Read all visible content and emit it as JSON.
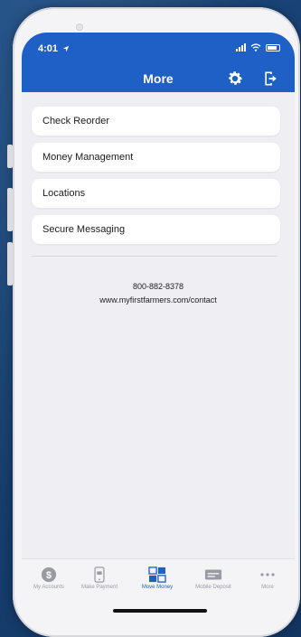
{
  "status_bar": {
    "time": "4:01"
  },
  "header": {
    "title": "More",
    "settings_icon": "gear-icon",
    "logout_icon": "logout-icon"
  },
  "menu": {
    "items": [
      {
        "label": "Check Reorder"
      },
      {
        "label": "Money Management"
      },
      {
        "label": "Locations"
      },
      {
        "label": "Secure Messaging"
      }
    ]
  },
  "contact": {
    "phone": "800-882-8378",
    "url": "www.myfirstfarmers.com/contact"
  },
  "tabbar": {
    "tabs": [
      {
        "label": "My Accounts",
        "icon": "dollar-circle-icon"
      },
      {
        "label": "Make Payment",
        "icon": "phone-payment-icon"
      },
      {
        "label": "Move Money",
        "icon": "transfer-icon",
        "active": true
      },
      {
        "label": "Mobile Deposit",
        "icon": "check-deposit-icon"
      },
      {
        "label": "More",
        "icon": "more-dots-icon"
      }
    ]
  },
  "colors": {
    "brand_blue": "#1f60c6",
    "screen_bg": "#eeeef3",
    "inactive_tab": "#9a9aa3"
  }
}
